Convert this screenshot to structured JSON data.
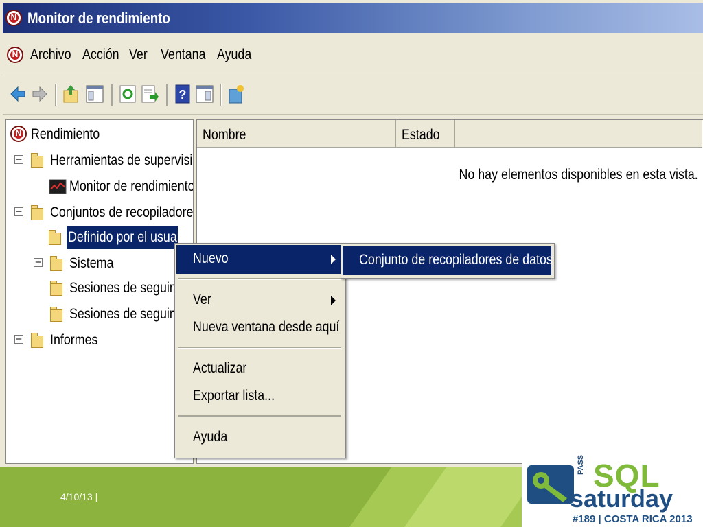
{
  "window": {
    "title": "Monitor de rendimiento"
  },
  "menubar": {
    "items": [
      "Archivo",
      "Acción",
      "Ver",
      "Ventana",
      "Ayuda"
    ]
  },
  "toolbar": {
    "buttons": [
      "back-arrow-icon",
      "forward-arrow-icon",
      "up-folder-icon",
      "show-hide-tree-icon",
      "refresh-icon",
      "export-list-icon",
      "help-icon",
      "properties-icon",
      "new-window-icon"
    ]
  },
  "tree": {
    "root": "Rendimiento",
    "items": [
      {
        "label": "Herramientas de supervisión",
        "expander": "−"
      },
      {
        "label": "Monitor de rendimiento"
      },
      {
        "label": "Conjuntos de recopiladores de",
        "expander": "−"
      },
      {
        "label": "Definido por el usuario"
      },
      {
        "label": "Sistema",
        "expander": "+"
      },
      {
        "label": "Sesiones de seguimien"
      },
      {
        "label": "Sesiones de seguimien"
      },
      {
        "label": "Informes",
        "expander": "+"
      }
    ]
  },
  "list": {
    "columns": [
      "Nombre",
      "Estado"
    ],
    "empty_message": "No hay elementos disponibles en esta vista."
  },
  "context_menu": {
    "items": [
      "Nuevo",
      "Ver",
      "Nueva ventana desde aquí",
      "Actualizar",
      "Exportar lista...",
      "Ayuda"
    ]
  },
  "submenu": {
    "items": [
      "Conjunto de recopiladores de datos"
    ]
  },
  "footer": {
    "date": "4/10/13   |",
    "logo": {
      "pass": "PASS",
      "sql": "SQL",
      "saturday": "saturday",
      "tagline": "#189 | COSTA RICA 2013"
    }
  },
  "colors": {
    "selection": "#0a246a",
    "footer_green": "#8db33f",
    "logo_blue": "#1e4e82",
    "logo_green": "#7fba3a"
  }
}
